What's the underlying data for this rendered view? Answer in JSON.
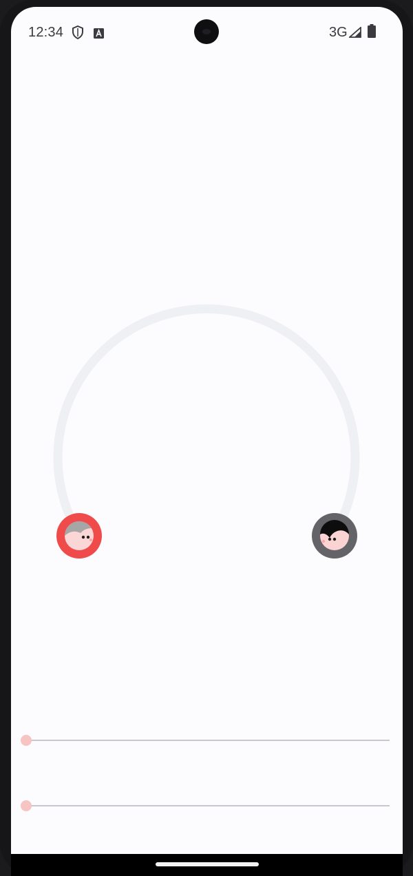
{
  "status_bar": {
    "time": "12:34",
    "network": "3G",
    "icons": [
      "shield-icon",
      "text-a-icon",
      "signal-icon",
      "battery-icon"
    ]
  },
  "arc": {
    "track_color": "#eef0f4",
    "left_avatar": {
      "ring_color": "#f04b4b",
      "hair_color": "#a6a6a6"
    },
    "right_avatar": {
      "ring_color": "#636368",
      "hair_color": "#0d0d0d"
    }
  },
  "sliders": [
    {
      "value": 0,
      "thumb_color": "#f7c4c4"
    },
    {
      "value": 0,
      "thumb_color": "#f7c4c4"
    }
  ]
}
